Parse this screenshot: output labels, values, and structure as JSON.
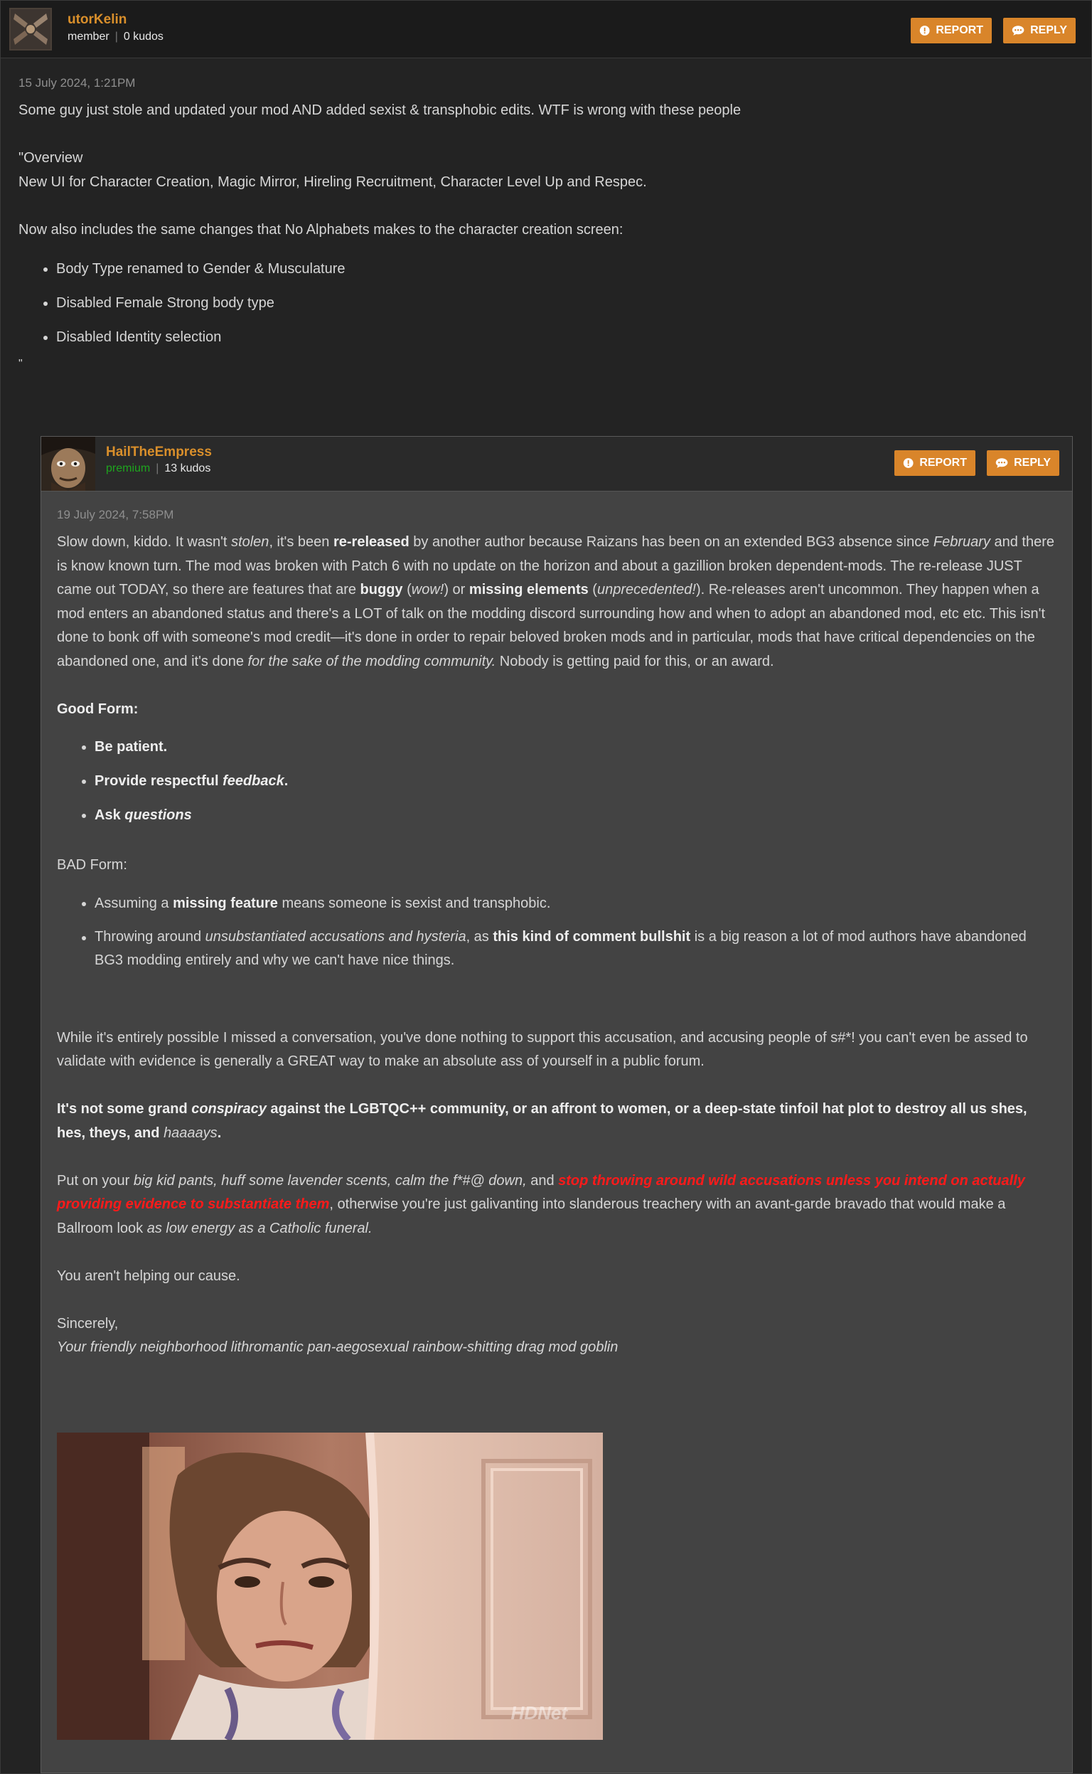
{
  "op": {
    "username": "utorKelin",
    "role": "member",
    "kudos": "0 kudos",
    "report_label": "REPORT",
    "reply_label": "REPLY",
    "date": "15 July 2024, 1:21PM",
    "line1": "Some guy just stole and updated your mod AND added sexist & transphobic edits. WTF is wrong with these people",
    "overview": "\"Overview",
    "line2": "New UI for Character Creation, Magic Mirror, Hireling Recruitment, Character Level Up and Respec.",
    "line3": "Now also includes the same changes that No Alphabets makes to the character creation screen:",
    "bullets": [
      "Body Type renamed to Gender & Musculature",
      "Disabled Female Strong body type",
      "Disabled Identity selection"
    ],
    "closing_quote": "\""
  },
  "reply": {
    "username": "HailTheEmpress",
    "role": "premium",
    "kudos": "13 kudos",
    "report_label": "REPORT",
    "reply_label": "REPLY",
    "date": "19 July 2024, 7:58PM",
    "p1": {
      "a": "Slow down, kiddo. It wasn't ",
      "b": "stolen",
      "c": ", it's been ",
      "d": "re-released",
      "e": " by another author because Raizans has been on an extended BG3 absence since ",
      "f": "February",
      "g": " and there is know known turn. The mod was broken with Patch 6 with no update on the horizon and about a gazillion broken dependent-mods. The re-release JUST came out TODAY, so there are features that are ",
      "h": "buggy",
      "i": " (",
      "j": "wow!",
      "k": ") or ",
      "l": "missing elements",
      "m": " (",
      "n": "unprecedented!",
      "o": "). Re-releases aren't uncommon. They happen when a mod enters an abandoned status and there's a LOT of talk on the modding discord surrounding how and when to adopt an abandoned mod, etc etc. This isn't done to bonk off with someone's mod credit—it's done in order to repair beloved broken mods and in particular, mods that have critical dependencies on the abandoned one, and it's done ",
      "p": "for the sake of the modding community.",
      "q": " Nobody is getting paid for this, or an award."
    },
    "good_form": "Good Form:",
    "good_items": {
      "g1": "Be patient.",
      "g2a": "Provide respectful ",
      "g2b": "feedback",
      "g2c": ".",
      "g3a": "Ask ",
      "g3b": "questions"
    },
    "bad_form": "BAD Form:",
    "bad_items": {
      "b1a": "Assuming a ",
      "b1b": "missing feature",
      "b1c": " means someone is sexist and transphobic.",
      "b2a": "Throwing around ",
      "b2b": "unsubstantiated accusations and hysteria",
      "b2c": ", as ",
      "b2d": "this kind of comment bullshit",
      "b2e": " is a big reason a lot of mod authors have abandoned BG3 modding entirely and why we can't have nice things."
    },
    "p2": "While it's entirely possible I missed a conversation, you've done nothing to support this accusation, and accusing people of s#*! you can't even be assed to validate with evidence is generally a GREAT way to make an absolute ass of yourself in a public forum.",
    "p3": {
      "a": "It's not some grand ",
      "b": "conspiracy",
      "c": " against the LGBTQC++ community, or an affront to women, or a deep-state tinfoil hat plot to destroy all us shes, hes, theys, and ",
      "d": "haaaays",
      "e": "."
    },
    "p4": {
      "a": "Put on your ",
      "b": "big kid pants, huff some lavender scents, calm the f*#@ down,",
      "c": " and ",
      "d": "stop throwing around wild accusations unless you intend on actually providing evidence to substantiate them",
      "e": ", otherwise you're just galivanting into slanderous treachery with an avant-garde bravado that would make a Ballroom look ",
      "f": "as low energy as a Catholic funeral."
    },
    "p5": "You aren't helping our cause.",
    "p6": "Sincerely,",
    "p7": "Your friendly neighborhood lithromantic pan-aegosexual rainbow-shitting drag mod goblin",
    "gif_watermark": "HDNet"
  },
  "colors": {
    "accent": "#d9852a",
    "username": "#d98f2b",
    "premium": "#1ea51e",
    "alert_red": "#ff1a1a"
  },
  "icons": [
    "alert-icon",
    "chat-bubble-icon"
  ]
}
